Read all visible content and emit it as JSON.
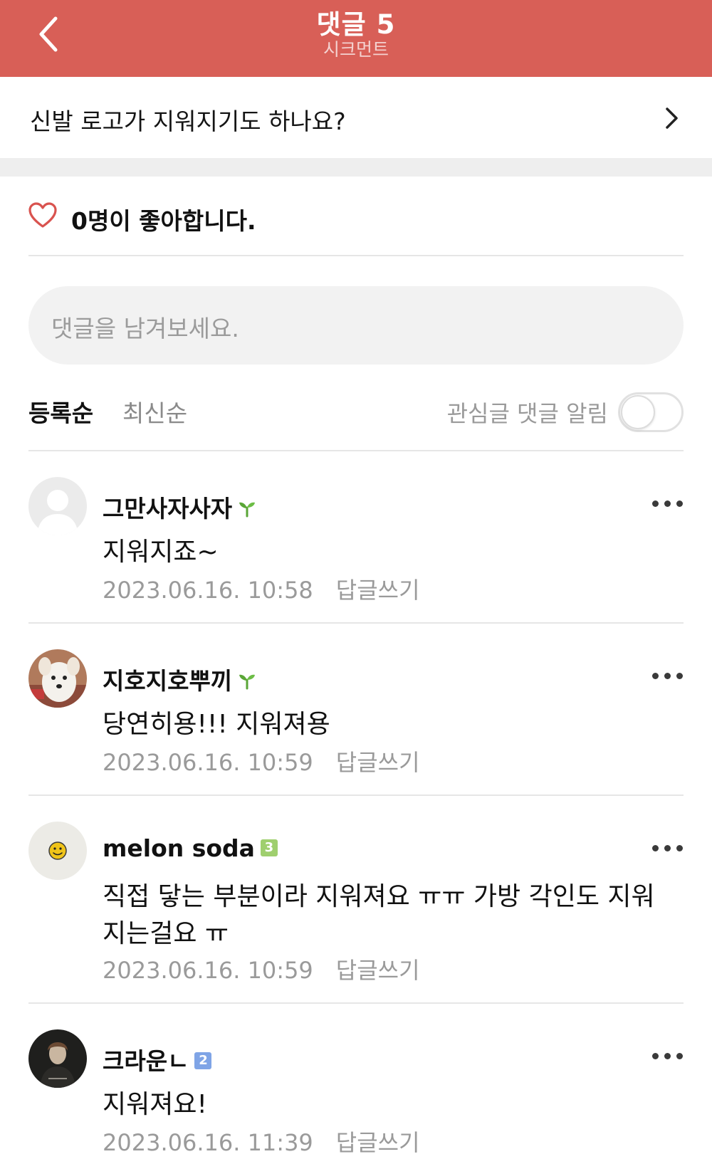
{
  "header": {
    "title": "댓글 5",
    "subtitle": "시크먼트",
    "background_color": "#d85f57"
  },
  "post": {
    "title": "신발 로고가 지워지기도 하나요?"
  },
  "likes": {
    "text": "0명이 좋아합니다."
  },
  "comment_input": {
    "placeholder": "댓글을 남겨보세요."
  },
  "sort": {
    "tabs": [
      {
        "label": "등록순",
        "selected": true
      },
      {
        "label": "최신순",
        "selected": false
      }
    ],
    "notify_label": "관심글 댓글 알림",
    "notify_enabled": false
  },
  "comments": [
    {
      "author": "그만사자사자",
      "badge": "sprout-icon",
      "text": "지워지죠~",
      "date": "2023.06.16. 10:58",
      "reply_label": "답글쓰기",
      "avatar": "default-avatar"
    },
    {
      "author": "지호지호뿌끼",
      "badge": "sprout-icon",
      "text": "당연히용!!! 지워져용",
      "date": "2023.06.16. 10:59",
      "reply_label": "답글쓰기",
      "avatar": "puppy-photo"
    },
    {
      "author": "melon soda",
      "badge": "3",
      "badge_color": "#9fcf6e",
      "text": "직접 닿는 부분이라 지워져요 ㅠㅠ 가방 각인도 지워지는걸요 ㅠ",
      "date": "2023.06.16. 10:59",
      "reply_label": "답글쓰기",
      "avatar": "smiley-photo"
    },
    {
      "author": "크라운ㄴ",
      "badge": "2",
      "badge_color": "#7fa4e6",
      "text": "지워져요!",
      "date": "2023.06.16. 11:39",
      "reply_label": "답글쓰기",
      "avatar": "portrait-photo"
    }
  ]
}
